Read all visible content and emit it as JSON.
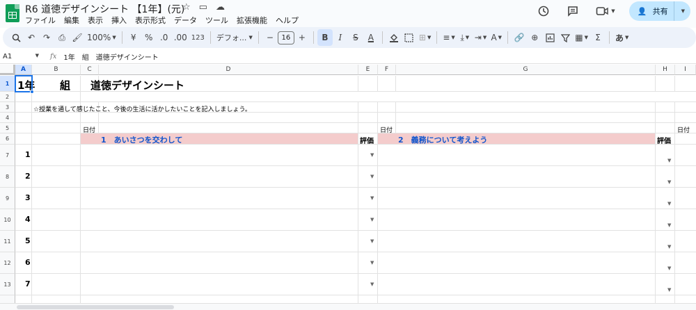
{
  "app": {
    "doc_title": "R6 道徳デザインシート 【1年】(元)",
    "menu": [
      "ファイル",
      "編集",
      "表示",
      "挿入",
      "表示形式",
      "データ",
      "ツール",
      "拡張機能",
      "ヘルプ"
    ],
    "share_label": "共有",
    "brand_color": "#0f9d58",
    "accent_color": "#1a73e8"
  },
  "toolbar": {
    "zoom": "100%",
    "currency": "¥",
    "percent": "%",
    "dec_decrease": ".0",
    "dec_increase": ".00",
    "number_format": "123",
    "font": "デフォ...",
    "font_size": "16",
    "bold": "B",
    "italic": "I",
    "strike": "S",
    "text_color": "A",
    "input_tools": "あ",
    "sum": "Σ"
  },
  "formula_bar": {
    "cell_ref": "A1",
    "fx": "fx",
    "content": "1年　組　道徳デザインシート"
  },
  "sheet": {
    "columns": [
      "A",
      "B",
      "C",
      "D",
      "E",
      "F",
      "G",
      "H",
      "I"
    ],
    "rows": [
      "1",
      "2",
      "3",
      "4",
      "5",
      "6",
      "7",
      "8",
      "9",
      "10",
      "11",
      "12",
      "13"
    ],
    "title_year": "1年",
    "title_class": "組",
    "title_name": "道徳デザインシート",
    "instruction": "☆授業を通して感じたこと、今後の生活に活かしたいことを記入しましょう。",
    "date_label": "日付",
    "eval_label": "評価",
    "lesson1": "1　あいさつを交わして",
    "lesson2": "2　義務について考えよう",
    "numbers": [
      "1",
      "2",
      "3",
      "4",
      "5",
      "6",
      "7"
    ],
    "header_fill": "#f4cccc",
    "lesson_color": "#1155cc"
  }
}
